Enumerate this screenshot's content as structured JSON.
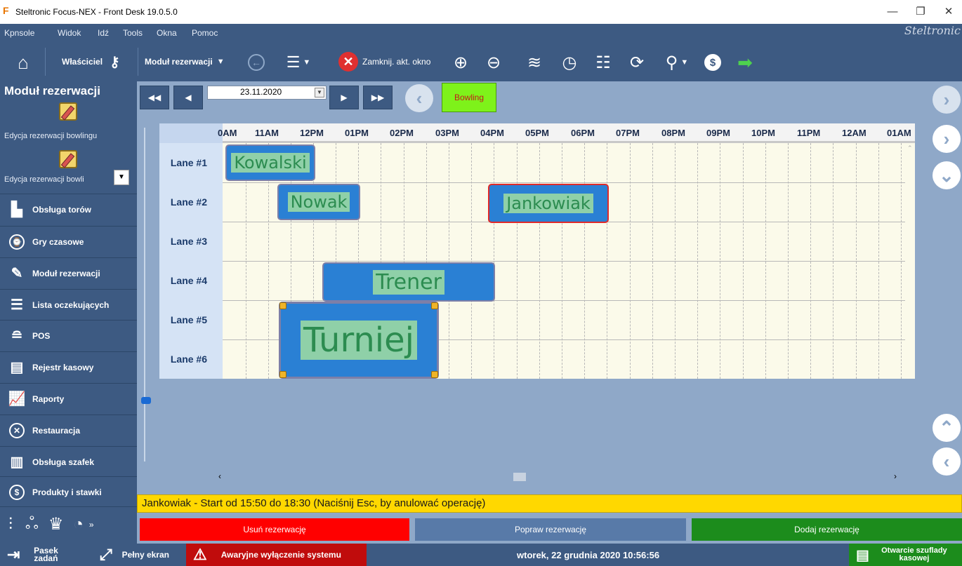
{
  "window": {
    "title": "Steltronic Focus-NEX - Front Desk 19.0.5.0"
  },
  "menu": {
    "items": [
      "Kpnsole",
      "Widok",
      "Idź",
      "Tools",
      "Okna",
      "Pomoc"
    ],
    "brand": "Steltronic"
  },
  "toolbar": {
    "owner_label": "Właściciel",
    "module_label": "Moduł rezerwacji",
    "close_label": "Zamknij. akt. okno"
  },
  "left_panel": {
    "title": "Moduł rezerwacji",
    "edit_items": [
      "Edycja rezerwacji bowlingu",
      "Edycja rezerwacji bowli"
    ],
    "nav": [
      {
        "label": "Obsługa torów",
        "icon": "lanes-icon"
      },
      {
        "label": "Gry czasowe",
        "icon": "timer-icon"
      },
      {
        "label": "Moduł rezerwacji",
        "icon": "edit-icon"
      },
      {
        "label": "Lista oczekujących",
        "icon": "list-icon"
      },
      {
        "label": "POS",
        "icon": "burger-icon"
      },
      {
        "label": "Rejestr kasowy",
        "icon": "register-icon"
      },
      {
        "label": "Raporty",
        "icon": "chart-icon"
      },
      {
        "label": "Restauracja",
        "icon": "restaurant-icon"
      },
      {
        "label": "Obsługa szafek",
        "icon": "locker-icon"
      },
      {
        "label": "Produkty i stawki",
        "icon": "dollar-icon"
      }
    ]
  },
  "calendar": {
    "date": "23.11.2020",
    "bowling_label": "Bowling",
    "hours": [
      "0AM",
      "11AM",
      "12PM",
      "01PM",
      "02PM",
      "03PM",
      "04PM",
      "05PM",
      "06PM",
      "07PM",
      "08PM",
      "09PM",
      "10PM",
      "11PM",
      "12AM",
      "01AM"
    ],
    "lanes": [
      "Lane #1",
      "Lane #2",
      "Lane #3",
      "Lane #4",
      "Lane #5",
      "Lane #6"
    ],
    "reservations": [
      {
        "name": "Kowalski"
      },
      {
        "name": "Nowak"
      },
      {
        "name": "Jankowiak"
      },
      {
        "name": "Trener"
      },
      {
        "name": "Turniej"
      }
    ]
  },
  "status_message": "Jankowiak - Start od 15:50 do 18:30 (Naciśnij Esc, by anulować operację)",
  "actions": {
    "delete": "Usuń rezerwację",
    "edit": "Popraw rezerwację",
    "add": "Dodaj rezerwację"
  },
  "bottom": {
    "taskbar": "Pasek zadań",
    "fullscreen": "Pełny ekran",
    "emergency": "Awaryjne wyłączenie systemu",
    "datetime": "wtorek, 22 grudnia 2020 10:56:56",
    "cash_drawer": "Otwarcie szuflady kasowej"
  },
  "colors": {
    "accent": "#3d5a82",
    "status_yellow": "#ffd800",
    "delete_red": "#ff0000",
    "add_green": "#1c8c1c",
    "bowling_green": "#7ef21a"
  }
}
